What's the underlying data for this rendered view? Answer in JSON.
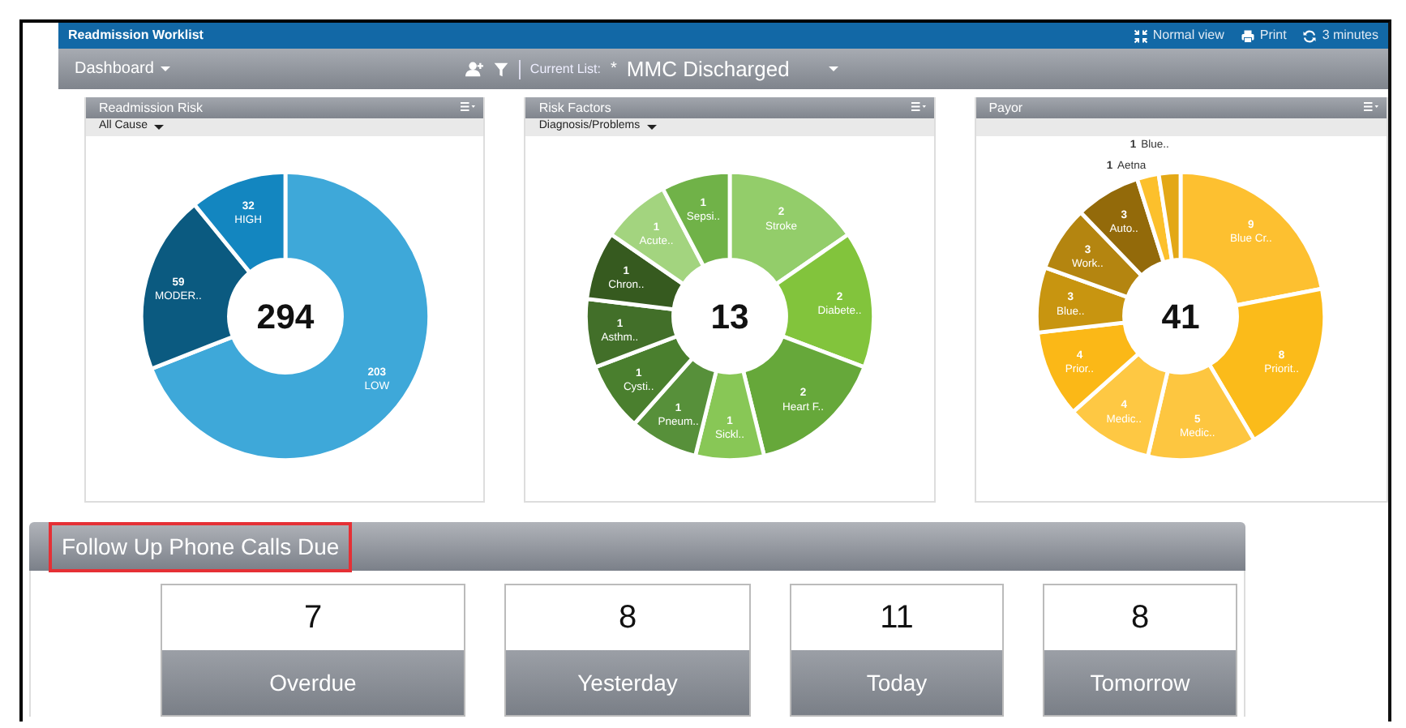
{
  "window": {
    "title": "Readmission Worklist"
  },
  "header_actions": [
    {
      "kind": "normal-view",
      "label": "Normal view"
    },
    {
      "kind": "print",
      "label": "Print"
    },
    {
      "kind": "refresh",
      "label": "3 minutes"
    }
  ],
  "toolbar": {
    "dashboard": "Dashboard",
    "current_list_label": "Current List:",
    "star": "*",
    "current_list": "MMC Discharged"
  },
  "panels": [
    {
      "title": "Readmission Risk",
      "filter": "All Cause",
      "chart_data": {
        "type": "donut",
        "title": "294",
        "categories": [
          "LOW",
          "MODER..",
          "HIGH"
        ],
        "values": [
          203,
          59,
          32
        ],
        "colors": [
          "#3ea8d9",
          "#0b5a80",
          "#1386c0"
        ],
        "value_labels": [
          "203",
          "59",
          "32"
        ]
      }
    },
    {
      "title": "Risk Factors",
      "filter": "Diagnosis/Problems",
      "chart_data": {
        "type": "donut",
        "title": "13",
        "categories": [
          "Stroke",
          "Diabete..",
          "Heart F..",
          "Sickl..",
          "Pneum..",
          "Cysti..",
          "Asthm..",
          "Chron..",
          "Acute..",
          "Sepsi.."
        ],
        "values": [
          2,
          2,
          2,
          1,
          1,
          1,
          1,
          1,
          1,
          1
        ],
        "colors": [
          "#93cd6a",
          "#82c43c",
          "#66a83a",
          "#88c756",
          "#57903a",
          "#4a7f2e",
          "#426f29",
          "#365a1f",
          "#a3d47f",
          "#70b248"
        ],
        "value_labels": [
          "2",
          "2",
          "2",
          "1",
          "1",
          "1",
          "1",
          "1",
          "1",
          "1"
        ]
      }
    },
    {
      "title": "Payor",
      "chart_data": {
        "type": "donut",
        "title": "41",
        "categories": [
          "Blue Cr..",
          "Priorit..",
          "Medic..",
          "Medic..",
          "Prior..",
          "Blue..",
          "Work..",
          "Auto..",
          "Aetna",
          "Blue.."
        ],
        "values": [
          9,
          8,
          5,
          4,
          4,
          3,
          3,
          3,
          1,
          1
        ],
        "colors": [
          "#fdc030",
          "#fbbb1a",
          "#fdc640",
          "#fec843",
          "#fbb817",
          "#c89510",
          "#b48510",
          "#936a0a",
          "#fcc02c",
          "#e3a816"
        ],
        "value_labels": [
          "9",
          "8",
          "5",
          "4",
          "4",
          "3",
          "3",
          "3",
          "1",
          "1"
        ]
      }
    }
  ],
  "follow_up": {
    "title": "Follow Up Phone Calls Due",
    "highlighted": true,
    "cards": [
      {
        "count": "7",
        "label": "Overdue"
      },
      {
        "count": "8",
        "label": "Yesterday"
      },
      {
        "count": "11",
        "label": "Today"
      },
      {
        "count": "8",
        "label": "Tomorrow"
      }
    ]
  }
}
